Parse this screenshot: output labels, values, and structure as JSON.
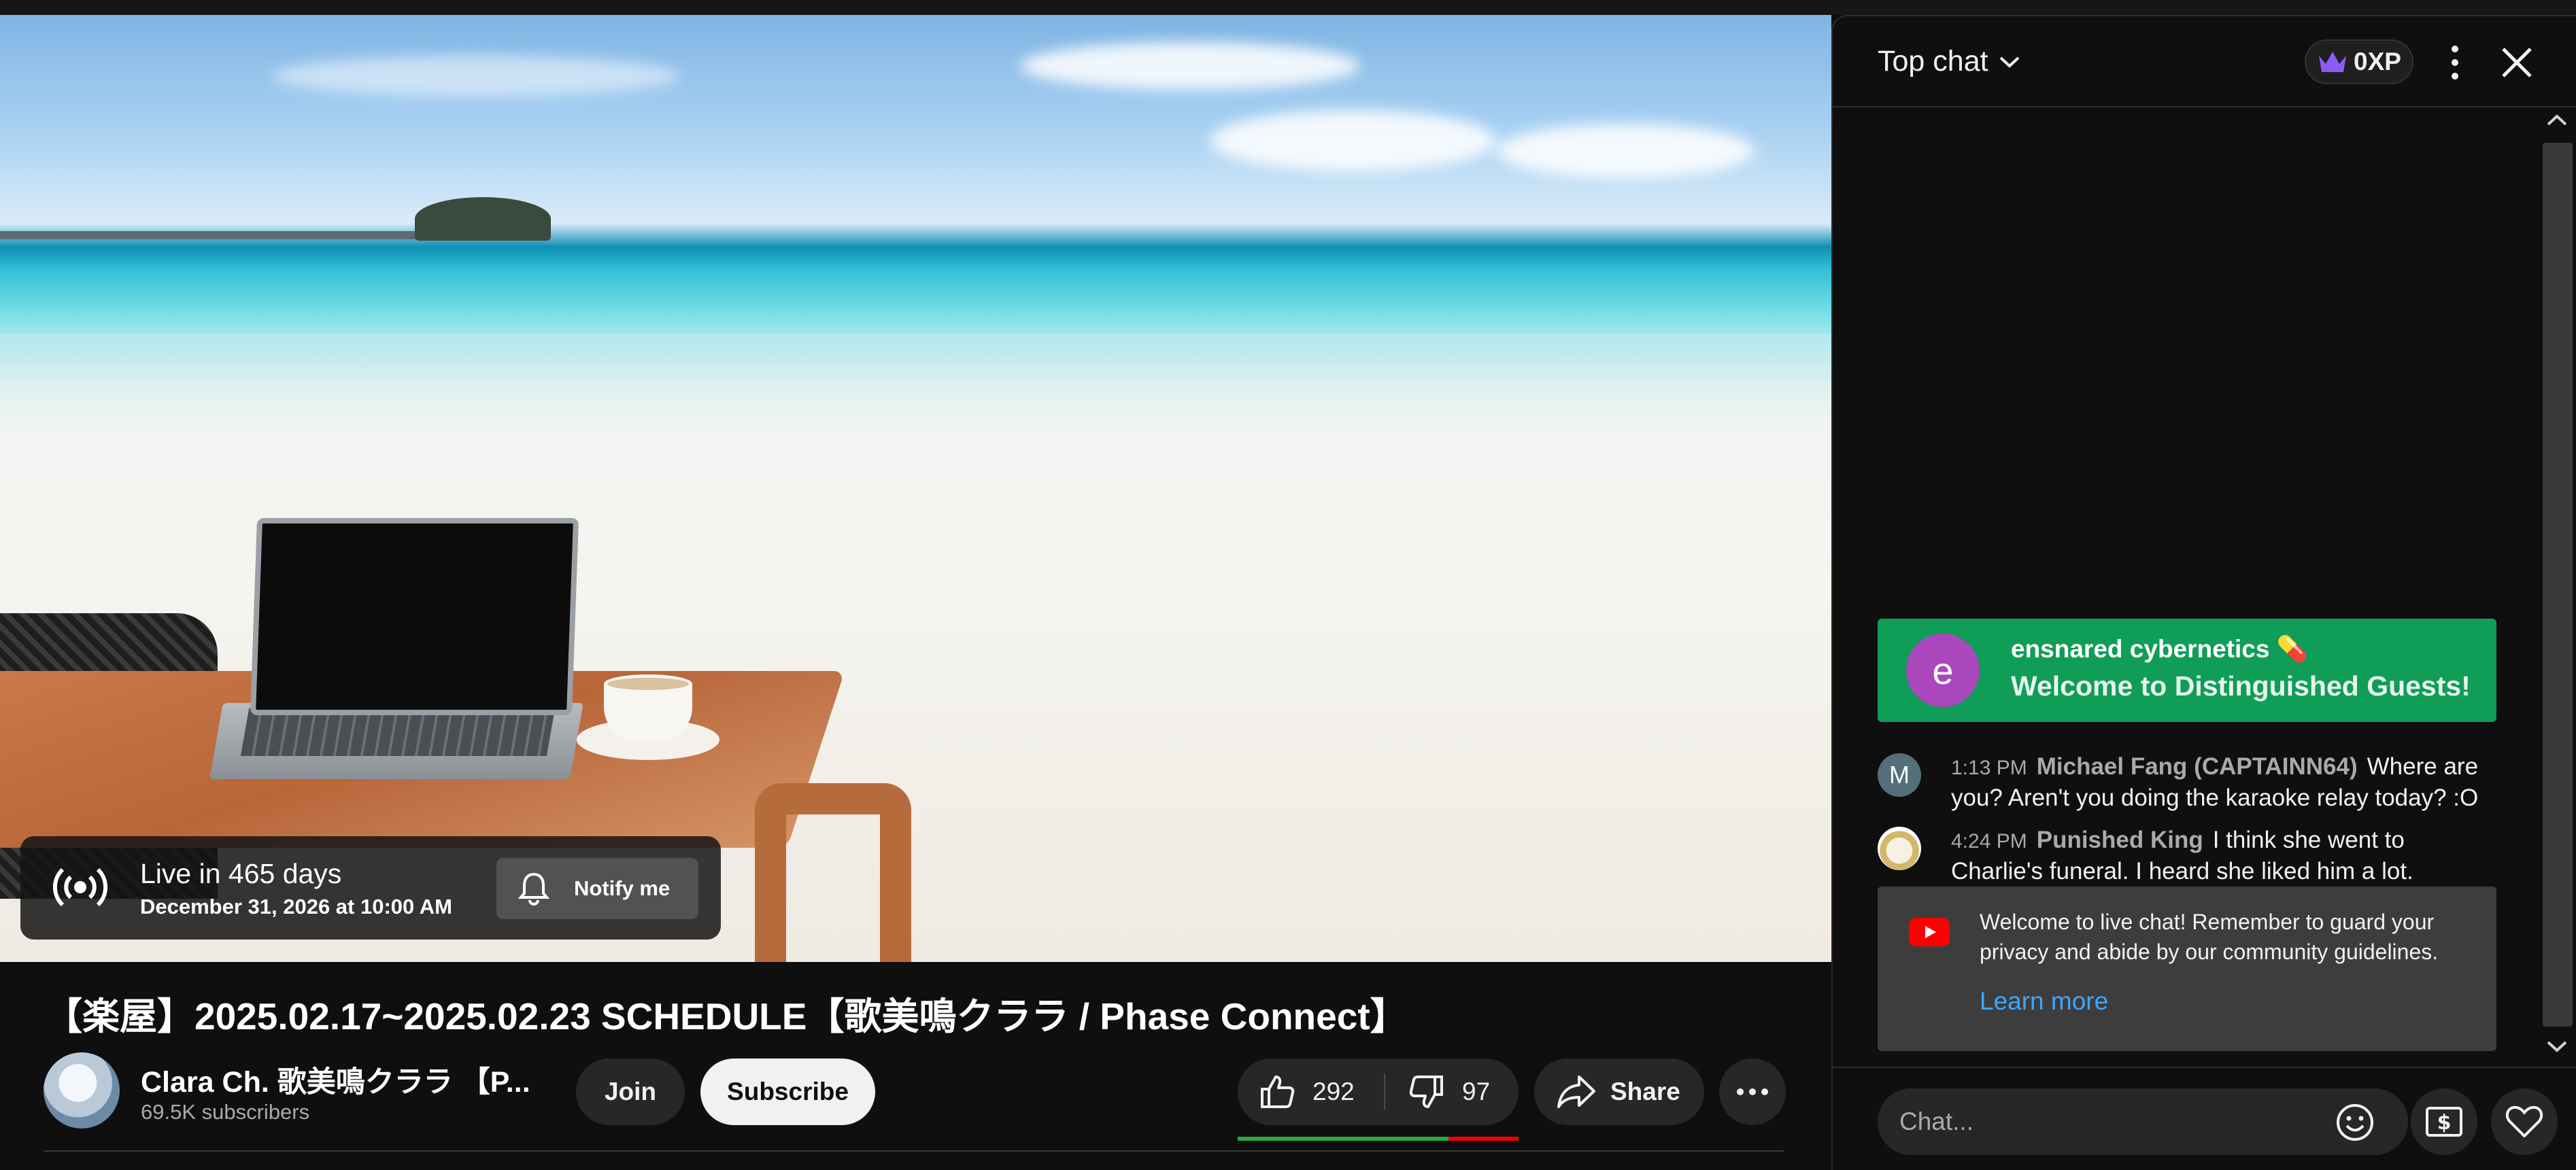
{
  "player": {
    "live_title": "Live in 465 days",
    "live_date": "December 31, 2026 at 10:00 AM",
    "notify_label": "Notify me"
  },
  "video": {
    "title": "【楽屋】2025.02.17~2025.02.23 SCHEDULE【歌美鳴クララ / Phase Connect】",
    "channel_name": "Clara Ch. 歌美鳴クララ 【P...",
    "subscribers": "69.5K subscribers",
    "join_label": "Join",
    "subscribe_label": "Subscribe",
    "likes": "292",
    "dislikes": "97",
    "like_ratio": 0.75,
    "share_label": "Share"
  },
  "chat": {
    "mode_label": "Top chat",
    "xp_label": "0XP",
    "welcome": {
      "avatar_letter": "e",
      "name": "ensnared cybernetics",
      "name_emoji": "💊",
      "message": "Welcome to Distinguished Guests!"
    },
    "messages": [
      {
        "avatar_letter": "M",
        "time": "1:13 PM",
        "author": "Michael Fang (CAPTAINN64)",
        "text": "Where are you? Aren't you doing the karaoke relay today? :O"
      },
      {
        "avatar_letter": "",
        "time": "4:24 PM",
        "author": "Punished King",
        "text": "I think she went to Charlie's funeral. I heard she liked him a lot."
      }
    ],
    "notice": {
      "text": "Welcome to live chat! Remember to guard your privacy and abide by our community guidelines.",
      "link": "Learn more"
    },
    "input_placeholder": "Chat..."
  },
  "colors": {
    "welcome_green": "#0f9d58",
    "link_blue": "#3ea6ff",
    "like_bar_green": "#2ba640",
    "dislike_bar_red": "#e00000",
    "crown_purple": "#8c5cf6"
  },
  "icons": [
    "broadcast-icon",
    "bell-icon",
    "thumbs-up-icon",
    "thumbs-down-icon",
    "share-icon",
    "more-horizontal-icon",
    "chevron-down-icon",
    "crown-icon",
    "more-vertical-icon",
    "close-icon",
    "youtube-logo-icon",
    "emoji-icon",
    "super-chat-icon",
    "heart-icon"
  ]
}
